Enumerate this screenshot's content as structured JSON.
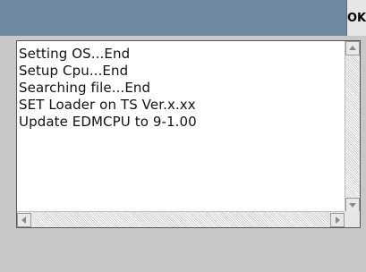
{
  "header": {
    "ok_label": "OK"
  },
  "log": {
    "lines": [
      "Setting OS...End",
      "Setup Cpu...End",
      "Searching file...End",
      "SET Loader on TS Ver.x.xx",
      "Update EDMCPU to 9-1.00"
    ]
  },
  "icons": {
    "scroll_up": "triangle-up-icon",
    "scroll_down": "triangle-down-icon",
    "scroll_left": "triangle-left-icon",
    "scroll_right": "triangle-right-icon"
  },
  "colors": {
    "titlebar": "#6d889f",
    "window_bg": "#c8c8c8",
    "list_bg": "#ffffff"
  }
}
